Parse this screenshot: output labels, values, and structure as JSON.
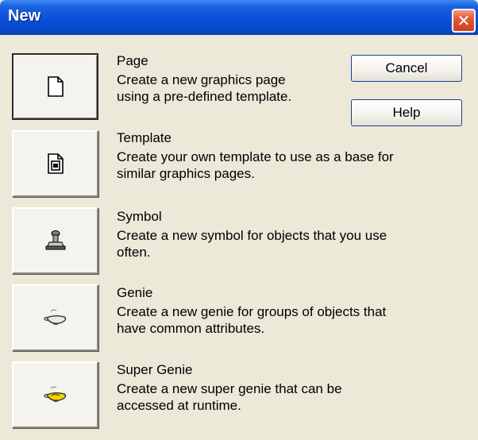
{
  "window": {
    "title": "New",
    "close_symbol": "✕"
  },
  "buttons": {
    "cancel_label": "Cancel",
    "help_label": "Help"
  },
  "items": [
    {
      "title": "Page",
      "description": "Create a new graphics page\nusing a pre-defined template.",
      "icon": "blank-page-icon"
    },
    {
      "title": "Template",
      "description": "Create your own template to use as a base for\nsimilar graphics pages.",
      "icon": "template-icon"
    },
    {
      "title": "Symbol",
      "description": "Create a new symbol for objects that you use\noften.",
      "icon": "stamp-icon"
    },
    {
      "title": "Genie",
      "description": "Create a new genie for groups of objects that\nhave common attributes.",
      "icon": "genie-lamp-icon"
    },
    {
      "title": "Super Genie",
      "description": "Create a new super genie that can be\naccessed at runtime.",
      "icon": "super-genie-lamp-icon"
    }
  ],
  "colors": {
    "titlebar": "#0a4fd6",
    "close_button": "#d33f1c",
    "dialog_background": "#ece9d8",
    "super_genie_accent": "#f2d400"
  }
}
